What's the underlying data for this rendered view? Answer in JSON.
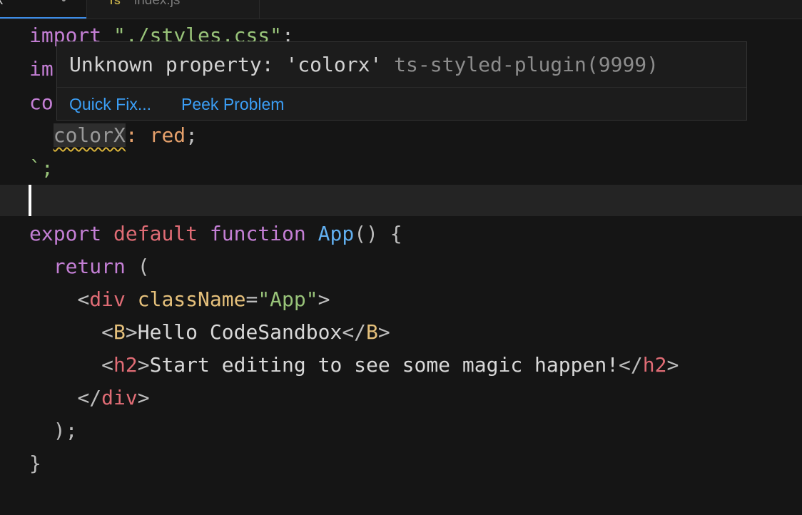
{
  "tabs": [
    {
      "label": "tsx",
      "dirty_marker": "•",
      "active": true
    },
    {
      "icon": "TS",
      "label": "index.js",
      "active": false
    }
  ],
  "hover": {
    "message": "Unknown property: 'colorx'",
    "source": "ts-styled-plugin(9999)",
    "actions": [
      "Quick Fix...",
      "Peek Problem"
    ]
  },
  "code": {
    "l1_kw": "import",
    "l1_str": "\"./styles.css\"",
    "l1_semi": ";",
    "l2": "im",
    "l3": "co",
    "l4_prop": "colorX",
    "l4_colon": ":",
    "l4_val": "red",
    "l4_semi": ";",
    "l5": "`;",
    "l7_export": "export",
    "l7_default": "default",
    "l7_function": "function",
    "l7_name": "App",
    "l7_rest": "() {",
    "l8_return": "return",
    "l8_paren": "(",
    "l9_open": "<",
    "l9_tag": "div",
    "l9_attr": "className",
    "l9_eq": "=",
    "l9_str": "\"App\"",
    "l9_close": ">",
    "l10_open": "<",
    "l10_tag": "B",
    "l10_gt": ">",
    "l10_text": "Hello CodeSandbox",
    "l10_close_open": "</",
    "l10_close_tag": "B",
    "l10_close_gt": ">",
    "l11_open": "<",
    "l11_tag": "h2",
    "l11_gt": ">",
    "l11_text": "Start editing to see some magic happen!",
    "l11_close_open": "</",
    "l11_close_tag": "h2",
    "l11_close_gt": ">",
    "l12_open": "</",
    "l12_tag": "div",
    "l12_gt": ">",
    "l13": ");",
    "l14": "}"
  }
}
